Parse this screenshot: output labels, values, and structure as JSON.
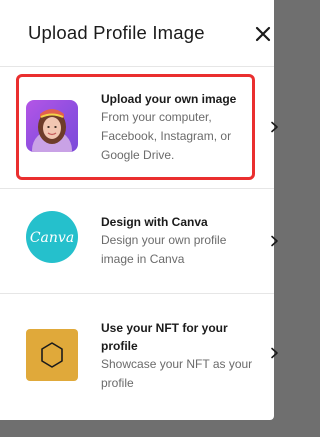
{
  "dialog": {
    "title": "Upload Profile Image",
    "close_icon": "close-icon"
  },
  "options": [
    {
      "title": "Upload your own image",
      "description": "From your computer, Facebook, Instagram, or Google Drive.",
      "icon": "profile-photo-thumbnail",
      "highlighted": true,
      "highlight_color": "#ea2f2f"
    },
    {
      "title": "Design with Canva",
      "description": "Design your own profile image in Canva",
      "icon": "canva-logo",
      "logo_text": "Canva",
      "accent": "#25c0cc"
    },
    {
      "title": "Use your NFT for your profile",
      "description": "Showcase your NFT as your profile",
      "icon": "nft-hexagon-icon",
      "accent": "#e0a93a"
    }
  ],
  "colors": {
    "overlay": "#6f6f6f",
    "surface": "#ffffff",
    "text": "#1b1b1b",
    "muted": "#6b6b6b"
  }
}
